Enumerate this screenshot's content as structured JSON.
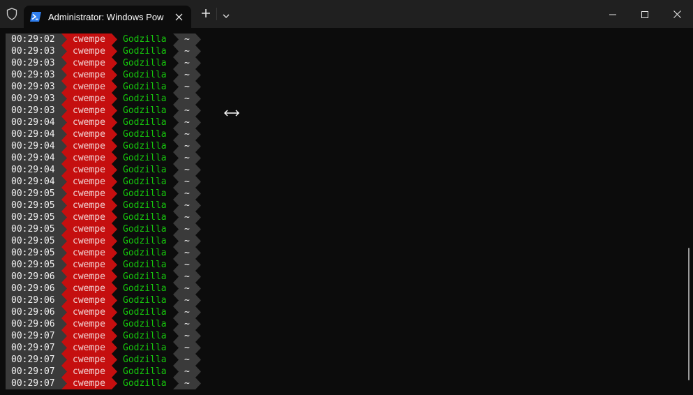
{
  "titlebar": {
    "tab_title": "Administrator: Windows PowerShell",
    "icons": {
      "shield": "shield-icon",
      "tab": "powershell-icon",
      "close_tab": "close-icon",
      "new_tab": "plus-icon",
      "dropdown": "chevron-down-icon",
      "minimize": "minimize-icon",
      "maximize": "maximize-icon",
      "close_window": "close-icon"
    }
  },
  "prompt": {
    "user": "cwempe",
    "host": "Godzilla",
    "dir": "~"
  },
  "colors": {
    "background": "#0c0c0c",
    "time_segment": "#3a3a3a",
    "user_segment": "#c50f0f",
    "host_text": "#16c60c"
  },
  "lines": [
    {
      "time": "00:29:02"
    },
    {
      "time": "00:29:03"
    },
    {
      "time": "00:29:03"
    },
    {
      "time": "00:29:03"
    },
    {
      "time": "00:29:03"
    },
    {
      "time": "00:29:03"
    },
    {
      "time": "00:29:03"
    },
    {
      "time": "00:29:04"
    },
    {
      "time": "00:29:04"
    },
    {
      "time": "00:29:04"
    },
    {
      "time": "00:29:04"
    },
    {
      "time": "00:29:04"
    },
    {
      "time": "00:29:04"
    },
    {
      "time": "00:29:05"
    },
    {
      "time": "00:29:05"
    },
    {
      "time": "00:29:05"
    },
    {
      "time": "00:29:05"
    },
    {
      "time": "00:29:05"
    },
    {
      "time": "00:29:05"
    },
    {
      "time": "00:29:05"
    },
    {
      "time": "00:29:06"
    },
    {
      "time": "00:29:06"
    },
    {
      "time": "00:29:06"
    },
    {
      "time": "00:29:06"
    },
    {
      "time": "00:29:06"
    },
    {
      "time": "00:29:07"
    },
    {
      "time": "00:29:07"
    },
    {
      "time": "00:29:07"
    },
    {
      "time": "00:29:07"
    },
    {
      "time": "00:29:07"
    }
  ]
}
